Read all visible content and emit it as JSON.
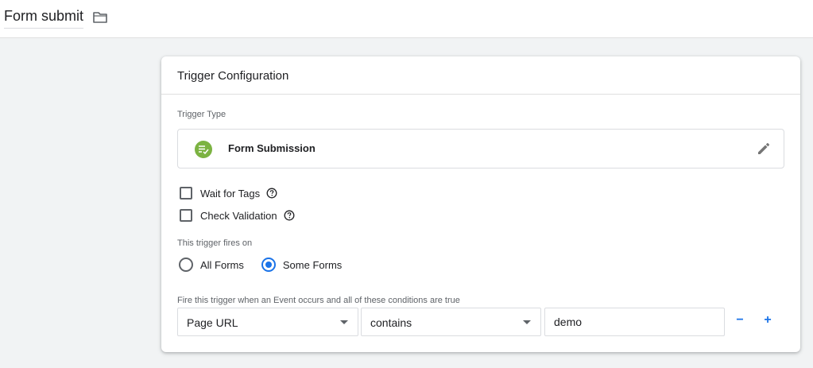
{
  "header": {
    "title": "Form submit",
    "folder_icon": "folder-icon"
  },
  "card": {
    "title": "Trigger Configuration",
    "trigger_type_label": "Trigger Type",
    "trigger_type": {
      "name": "Form Submission",
      "icon": "form-submission-icon",
      "icon_color": "#7cb342"
    },
    "options": [
      {
        "label": "Wait for Tags",
        "checked": false
      },
      {
        "label": "Check Validation",
        "checked": false
      }
    ],
    "fires_on_label": "This trigger fires on",
    "fires_on": {
      "all_forms": "All Forms",
      "some_forms": "Some Forms",
      "selected": "Some Forms"
    },
    "condition_label": "Fire this trigger when an Event occurs and all of these conditions are true",
    "condition": {
      "variable": "Page URL",
      "operator": "contains",
      "value": "demo"
    },
    "remove_label": "−",
    "add_label": "+"
  },
  "colors": {
    "accent": "#1a73e8",
    "trigger_icon": "#7cb342"
  }
}
